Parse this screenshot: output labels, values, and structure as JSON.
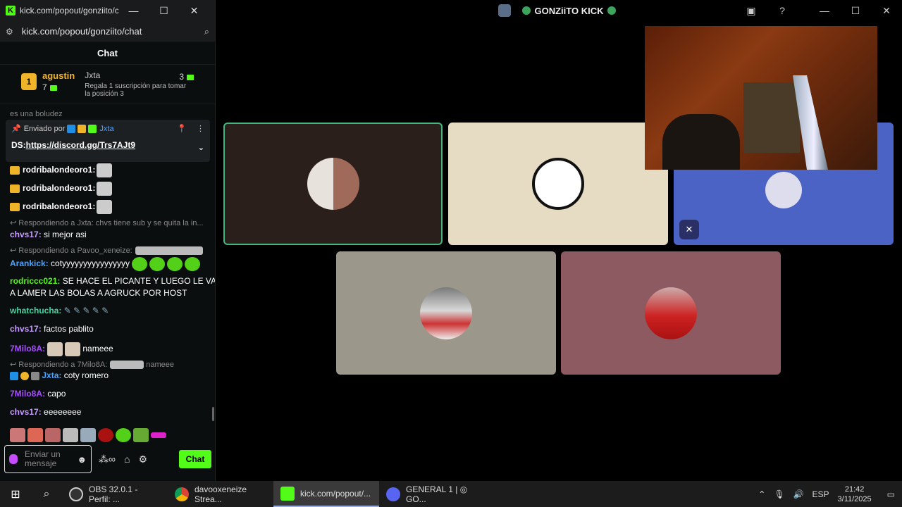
{
  "chat_window": {
    "title": "kick.com/popout/gonziito/c...",
    "url": "kick.com/popout/gonziito/chat",
    "header": "Chat",
    "leaderboard": {
      "first": {
        "rank": "1",
        "name": "agustin",
        "count": "7"
      },
      "second": {
        "name": "Jxta",
        "desc": "Regala 1 suscripción para tomar la posición 3",
        "count": "3"
      }
    },
    "partial_line": "es una boludez",
    "pinned": {
      "sent_by": "Enviado por",
      "user": "Jxta",
      "prefix": "DS:",
      "link": "https://discord.gg/Trs7AJt9"
    },
    "messages": [
      {
        "user": "rodribalondeoro1:",
        "text": "",
        "color": "#ffffff"
      },
      {
        "user": "rodribalondeoro1:",
        "text": "",
        "color": "#ffffff"
      },
      {
        "user": "rodribalondeoro1:",
        "text": "",
        "color": "#ffffff"
      },
      {
        "reply": "Respondiendo a Jxta: chvs tiene sub y se quita la in..."
      },
      {
        "user": "chvs17:",
        "text": "si mejor asi",
        "color": "#c89bff"
      },
      {
        "reply": "Respondiendo a Pavoo_xeneize:"
      },
      {
        "user": "Arankick:",
        "text": "cotyyyyyyyyyyyyyyyy",
        "color": "#4da3ff"
      },
      {
        "user": "rodriccc021:",
        "text": "SE HACE EL PICANTE Y LUEGO LE VA",
        "color": "#53fc18"
      },
      {
        "user": "",
        "text": "A LAMER LAS BOLAS A AGRUCK POR HOST",
        "color": "#53fc18"
      },
      {
        "user": "whatchucha:",
        "text": "",
        "color": "#3ad9a0"
      },
      {
        "user": "chvs17:",
        "text": "factos pablito",
        "color": "#c89bff"
      },
      {
        "user": "7Milo8A:",
        "text": "nameee",
        "color": "#a64dff"
      },
      {
        "reply": "Respondiendo a 7Milo8A:",
        "reply_tail": "nameee"
      },
      {
        "user": "Jxta:",
        "text": "coty romero",
        "color": "#4da3ff"
      },
      {
        "user": "7Milo8A:",
        "text": "capo",
        "color": "#a64dff"
      },
      {
        "user": "chvs17:",
        "text": "eeeeeeee",
        "color": "#c89bff"
      }
    ],
    "input_placeholder": "Enviar un mensaje",
    "chat_button": "Chat"
  },
  "main_window": {
    "title": "GONZiiTO KICK"
  },
  "taskbar": {
    "items": [
      "OBS 32.0.1 - Perfil: ...",
      "davooxeneize Strea...",
      "kick.com/popout/...",
      "GENERAL 1 | ◎ GO..."
    ],
    "lang": "ESP",
    "time": "21:42",
    "date": "3/11/2025"
  }
}
